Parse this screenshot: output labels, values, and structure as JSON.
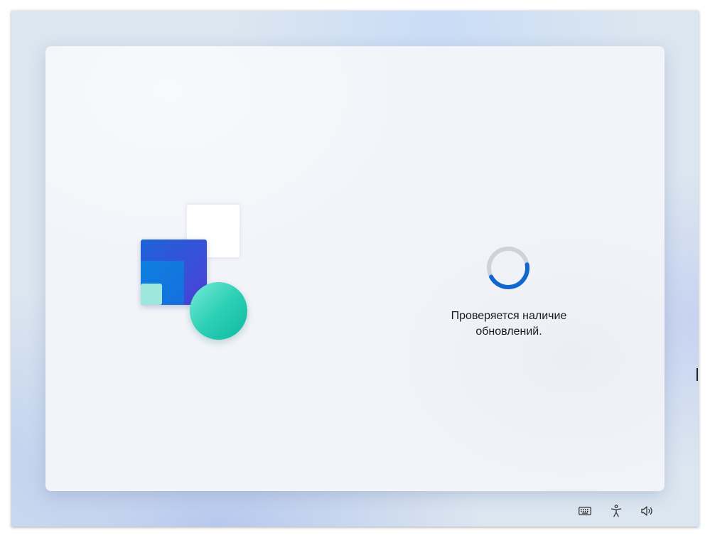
{
  "status": {
    "message": "Проверяется наличие\nобновлений."
  },
  "spinner": {
    "progress": 0.45,
    "track_color": "#cfd3d9",
    "arc_color": "#1266d0"
  },
  "illustration": {
    "colors": {
      "blue": "#1d63d8",
      "mint": "#9ee7dd",
      "teal": "#2ed0b5",
      "white": "#ffffff"
    }
  },
  "taskbar": {
    "icons": [
      "keyboard-icon",
      "accessibility-icon",
      "volume-icon"
    ]
  }
}
